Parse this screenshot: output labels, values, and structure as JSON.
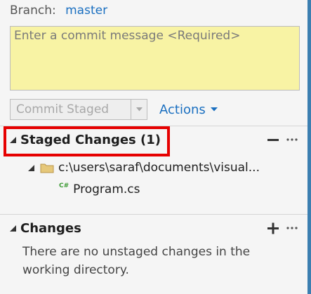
{
  "branch": {
    "label": "Branch:",
    "name": "master"
  },
  "commit": {
    "placeholder": "Enter a commit message <Required>",
    "button_label": "Commit Staged",
    "actions_label": "Actions"
  },
  "staged": {
    "header": "Staged Changes (1)",
    "folder_path": "c:\\users\\saraf\\documents\\visual...",
    "file_badge": "C#",
    "file_name": "Program.cs"
  },
  "changes": {
    "header": "Changes",
    "message": "There are no unstaged changes in the working directory."
  },
  "colors": {
    "accent": "#1a6fc0",
    "commit_box": "#f8f3a4",
    "highlight": "#e60000",
    "csharp_badge": "#3d9b35"
  },
  "icons": {
    "collapse": "triangle-collapse-icon",
    "folder": "folder-icon",
    "file": "csharp-file-icon",
    "minus": "unstage-all-icon",
    "plus": "stage-all-icon",
    "more": "more-options-icon"
  }
}
